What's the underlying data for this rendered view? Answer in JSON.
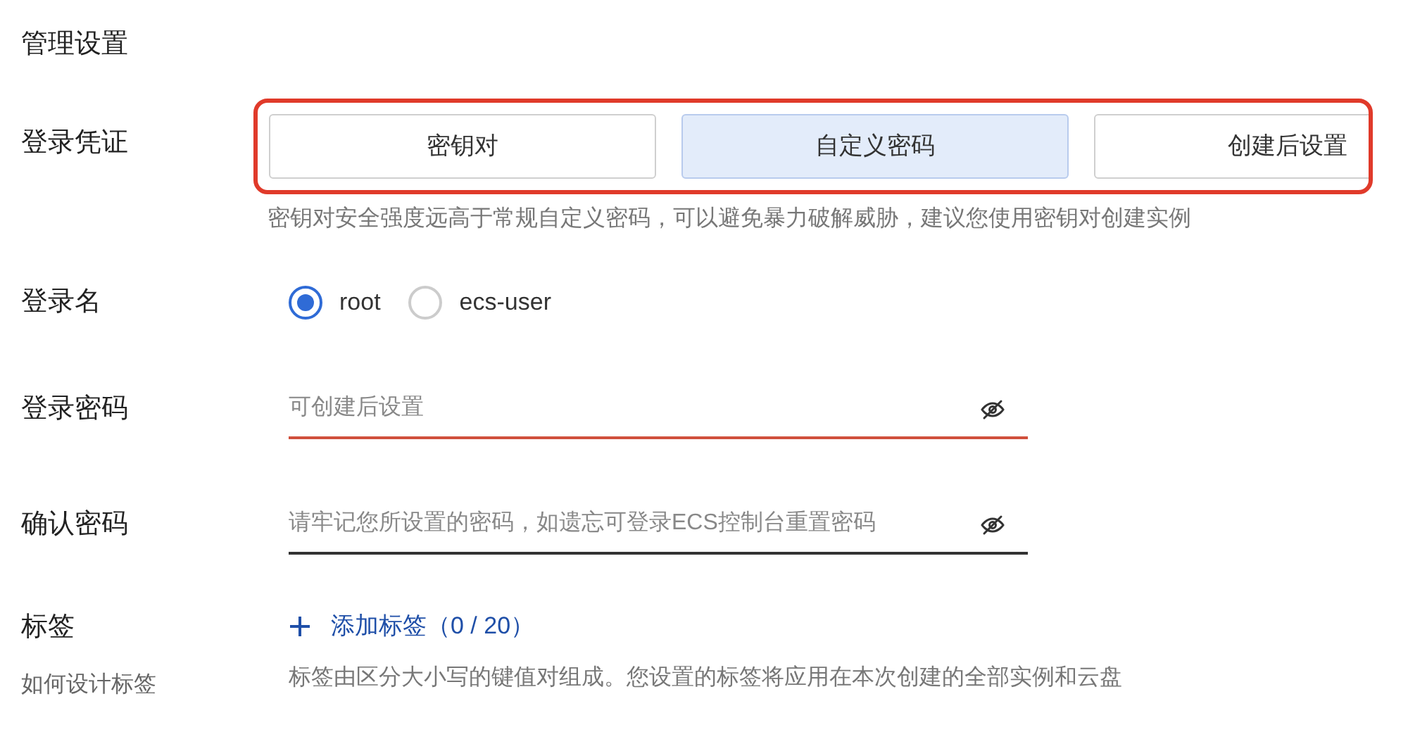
{
  "section_title": "管理设置",
  "credential": {
    "label": "登录凭证",
    "options": [
      {
        "label": "密钥对",
        "selected": false
      },
      {
        "label": "自定义密码",
        "selected": true
      },
      {
        "label": "创建后设置",
        "selected": false
      }
    ],
    "hint": "密钥对安全强度远高于常规自定义密码，可以避免暴力破解威胁，建议您使用密钥对创建实例"
  },
  "login_name": {
    "label": "登录名",
    "options": [
      {
        "label": "root",
        "selected": true
      },
      {
        "label": "ecs-user",
        "selected": false
      }
    ]
  },
  "password_fields": [
    {
      "label": "登录密码",
      "placeholder": "可创建后设置",
      "error": true
    },
    {
      "label": "确认密码",
      "placeholder": "请牢记您所设置的密码，如遗忘可登录ECS控制台重置密码",
      "error": false
    }
  ],
  "tags": {
    "label": "标签",
    "help_link": "如何设计标签",
    "add_label": "添加标签（0 / 20）",
    "hint": "标签由区分大小写的键值对组成。您设置的标签将应用在本次创建的全部实例和云盘"
  }
}
